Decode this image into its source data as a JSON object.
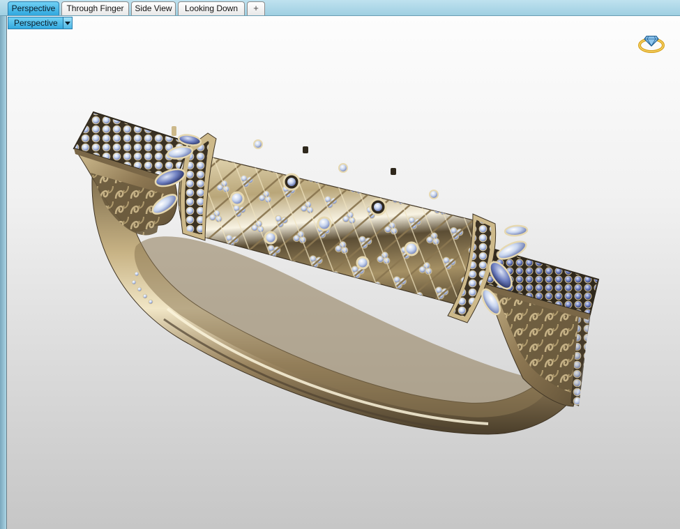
{
  "tabs": [
    {
      "label": "Perspective",
      "active": true
    },
    {
      "label": "Through Finger",
      "active": false
    },
    {
      "label": "Side View",
      "active": false
    },
    {
      "label": "Looking Down",
      "active": false
    }
  ],
  "add_tab_symbol": "+",
  "view_selector": {
    "selected": "Perspective"
  },
  "icons": {
    "nav_cube": "ring-diamond-icon",
    "dropdown": "chevron-down-icon"
  },
  "colors": {
    "active_tab": "#2fa7de",
    "tab_bar": "#a9d4e4",
    "gold": "#b7a173",
    "gem": "#c9d6ef"
  }
}
